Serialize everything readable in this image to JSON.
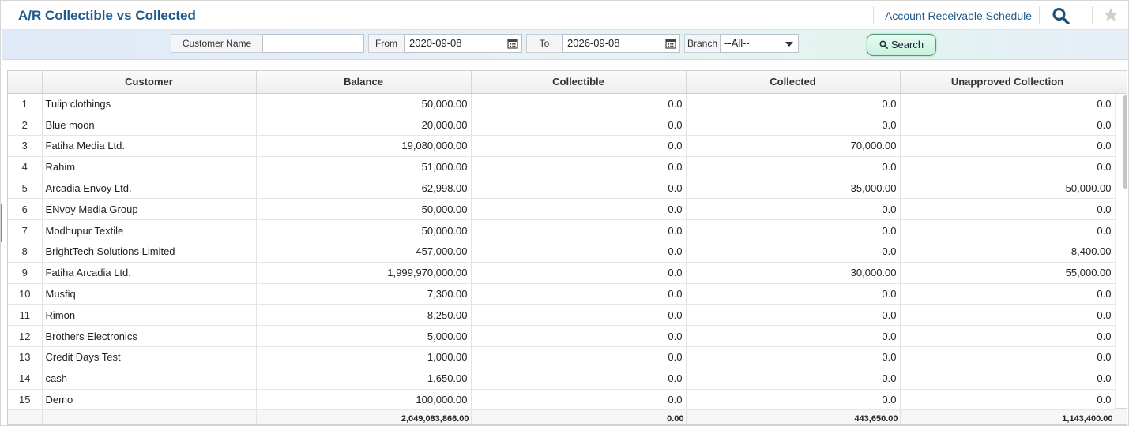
{
  "header": {
    "title": "A/R Collectible vs Collected",
    "link_label": "Account Receivable Schedule",
    "search_icon": "search-icon",
    "star_icon": "star-icon"
  },
  "filters": {
    "customer_label": "Customer Name",
    "customer_value": "",
    "from_label": "From",
    "from_value": "2020-09-08",
    "to_label": "To",
    "to_value": "2026-09-08",
    "branch_label": "Branch",
    "branch_value": "--All--",
    "search_label": "Search"
  },
  "table": {
    "columns": [
      "",
      "Customer",
      "Balance",
      "Collectible",
      "Collected",
      "Unapproved Collection"
    ],
    "rows": [
      [
        "1",
        "Tulip clothings",
        "50,000.00",
        "0.0",
        "0.0",
        "0.0"
      ],
      [
        "2",
        "Blue moon",
        "20,000.00",
        "0.0",
        "0.0",
        "0.0"
      ],
      [
        "3",
        "Fatiha Media Ltd.",
        "19,080,000.00",
        "0.0",
        "70,000.00",
        "0.0"
      ],
      [
        "4",
        "Rahim",
        "51,000.00",
        "0.0",
        "0.0",
        "0.0"
      ],
      [
        "5",
        "Arcadia Envoy Ltd.",
        "62,998.00",
        "0.0",
        "35,000.00",
        "50,000.00"
      ],
      [
        "6",
        "ENvoy Media Group",
        "50,000.00",
        "0.0",
        "0.0",
        "0.0"
      ],
      [
        "7",
        "Modhupur Textile",
        "50,000.00",
        "0.0",
        "0.0",
        "0.0"
      ],
      [
        "8",
        "BrightTech Solutions Limited",
        "457,000.00",
        "0.0",
        "0.0",
        "8,400.00"
      ],
      [
        "9",
        "Fatiha Arcadia Ltd.",
        "1,999,970,000.00",
        "0.0",
        "30,000.00",
        "55,000.00"
      ],
      [
        "10",
        "Musfiq",
        "7,300.00",
        "0.0",
        "0.0",
        "0.0"
      ],
      [
        "11",
        "Rimon",
        "8,250.00",
        "0.0",
        "0.0",
        "0.0"
      ],
      [
        "12",
        "Brothers Electronics",
        "5,000.00",
        "0.0",
        "0.0",
        "0.0"
      ],
      [
        "13",
        "Credit Days Test",
        "1,000.00",
        "0.0",
        "0.0",
        "0.0"
      ],
      [
        "14",
        "cash",
        "1,650.00",
        "0.0",
        "0.0",
        "0.0"
      ],
      [
        "15",
        "Demo",
        "100,000.00",
        "0.0",
        "0.0",
        "0.0"
      ]
    ],
    "totals": [
      "",
      "",
      "2,049,083,866.00",
      "0.00",
      "443,650.00",
      "1,143,400.00"
    ]
  },
  "colors": {
    "title": "#1e5a8c",
    "search_button": "#c9f1de",
    "accent": "#36b596"
  }
}
